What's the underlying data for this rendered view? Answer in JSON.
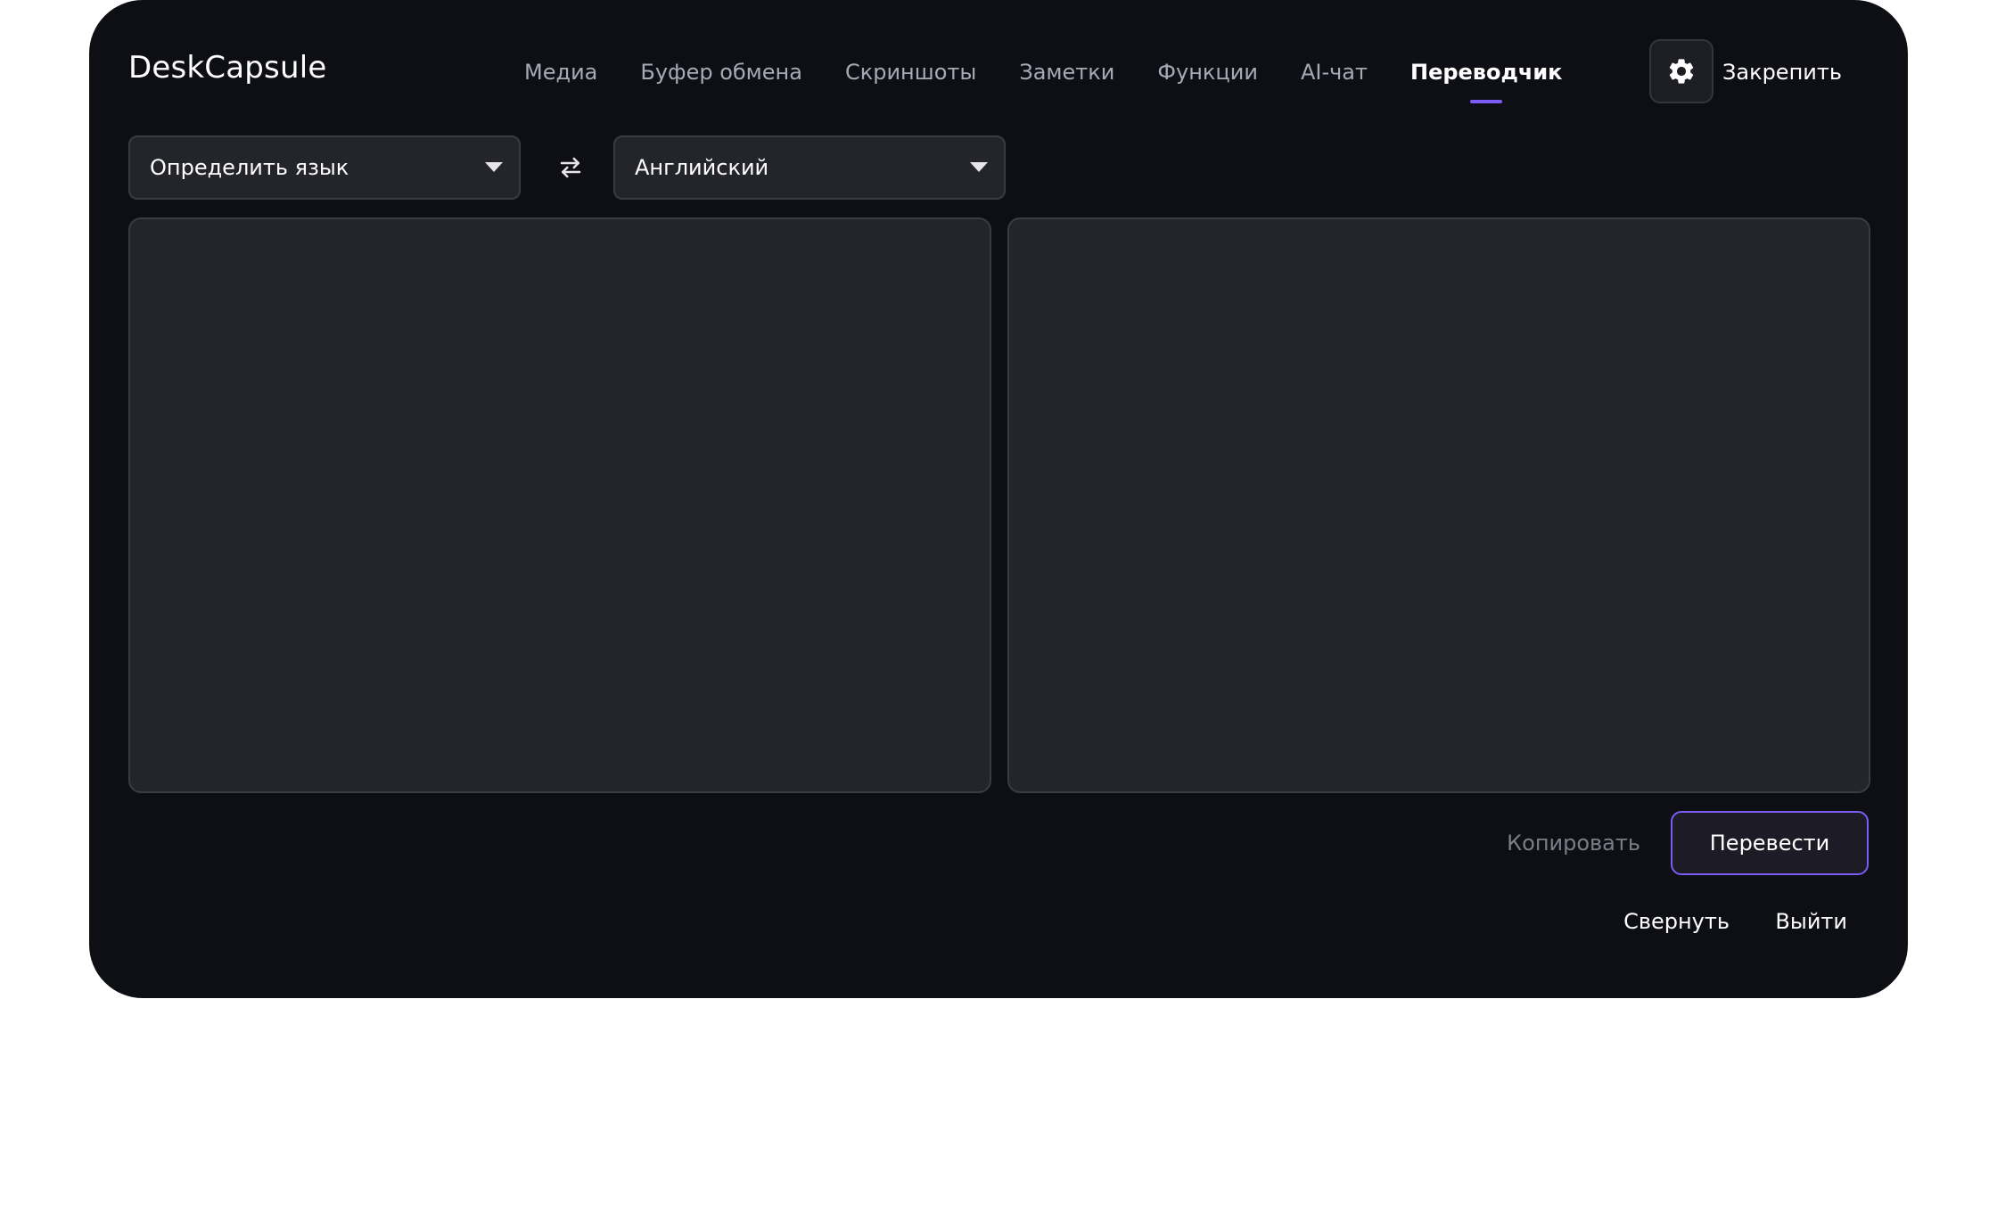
{
  "app": {
    "title": "DeskCapsule"
  },
  "nav": {
    "tabs": [
      {
        "label": "Медиа",
        "active": false
      },
      {
        "label": "Буфер обмена",
        "active": false
      },
      {
        "label": "Скриншоты",
        "active": false
      },
      {
        "label": "Заметки",
        "active": false
      },
      {
        "label": "Функции",
        "active": false
      },
      {
        "label": "AI-чат",
        "active": false
      },
      {
        "label": "Переводчик",
        "active": true
      }
    ],
    "settings_icon": "gear-icon",
    "pin_label": "Закрепить"
  },
  "translator": {
    "source_language": "Определить язык",
    "target_language": "Английский",
    "swap_icon": "swap-arrows-icon",
    "source_text": "",
    "translated_text": "",
    "copy_label": "Копировать",
    "translate_label": "Перевести"
  },
  "footer": {
    "minimize_label": "Свернуть",
    "exit_label": "Выйти"
  },
  "colors": {
    "window_bg": "#0e0f14",
    "panel_bg": "#24252a",
    "accent": "#7c5cf5",
    "muted_text": "#a6a9b6"
  }
}
